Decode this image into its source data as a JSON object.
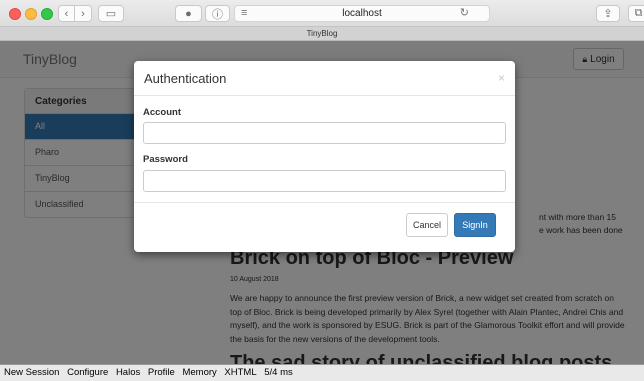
{
  "browser": {
    "address": "localhost",
    "tab_title": "TinyBlog"
  },
  "navbar": {
    "brand": "TinyBlog",
    "login_label": "Login"
  },
  "categories": {
    "heading": "Categories",
    "items": [
      {
        "label": "All",
        "active": true
      },
      {
        "label": "Pharo",
        "active": false
      },
      {
        "label": "TinyBlog",
        "active": false
      },
      {
        "label": "Unclassified",
        "active": false
      }
    ]
  },
  "background_post": {
    "fragment_line1": "nt with more than 15",
    "fragment_line2": "e work has been done",
    "title": "Brick on top of Bloc - Preview",
    "date": "10 August 2018",
    "body": "We are happy to announce the first preview version of Brick, a new widget set created from scratch on top of Bloc. Brick is being developed primarily by Alex Syrel (together with Alain Plantec, Andrei Chis and myself), and the work is sponsored by ESUG. Brick is part of the Glamorous Toolkit effort and will provide the basis for the new versions of the development tools.",
    "next_title": "The sad story of unclassified blog posts"
  },
  "modal": {
    "title": "Authentication",
    "close": "×",
    "account_label": "Account",
    "account_value": "",
    "password_label": "Password",
    "password_value": "",
    "cancel_label": "Cancel",
    "signin_label": "SignIn"
  },
  "toolbar": {
    "items": [
      "New Session",
      "Configure",
      "Halos",
      "Profile",
      "Memory",
      "XHTML"
    ],
    "timing": "5/4 ms"
  }
}
